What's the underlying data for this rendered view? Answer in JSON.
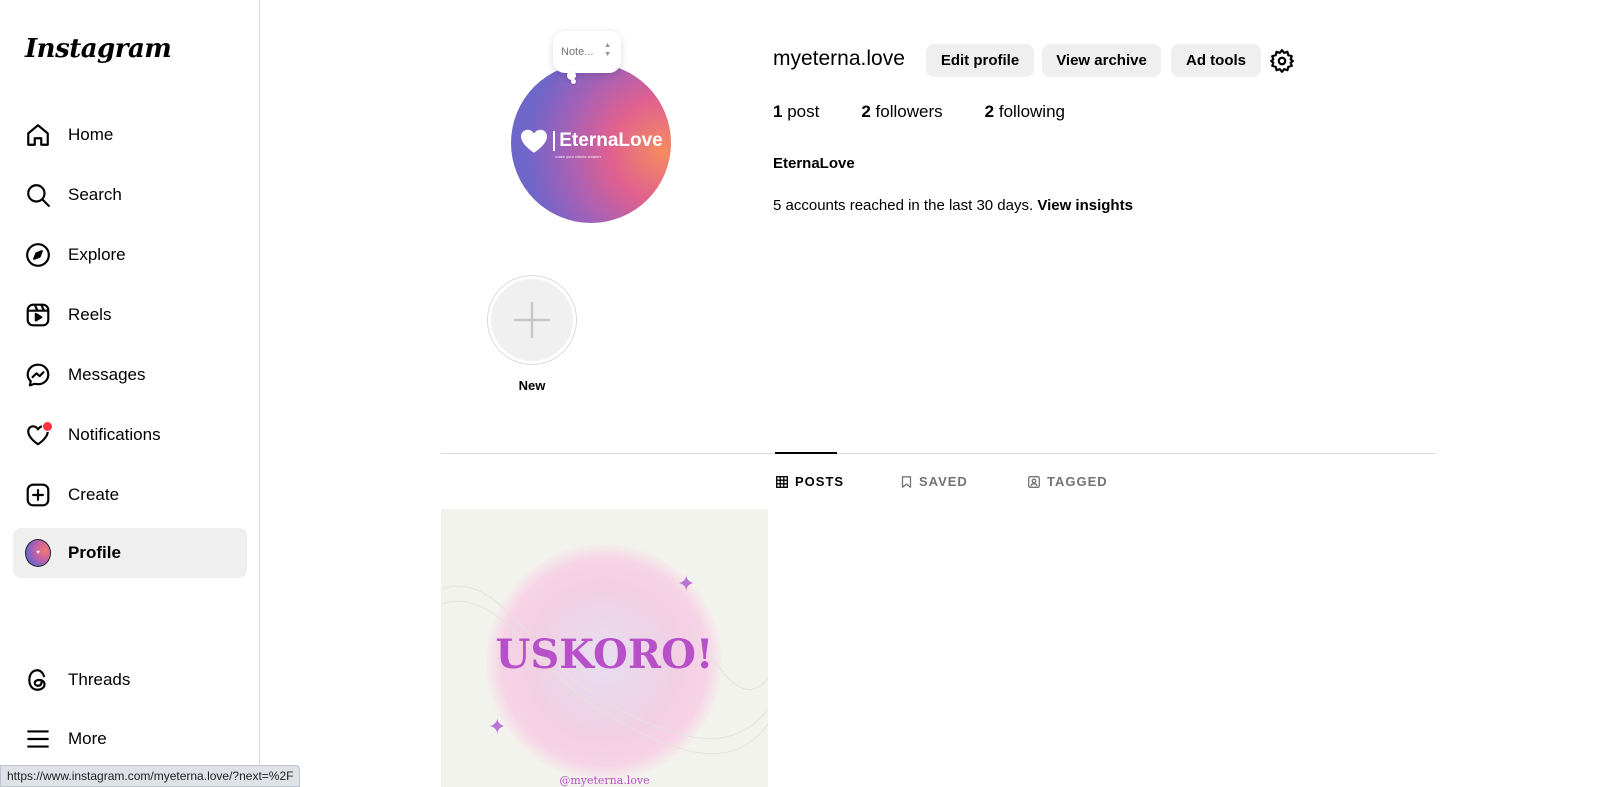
{
  "sidebar": {
    "logo": "Instagram",
    "items": [
      {
        "label": "Home"
      },
      {
        "label": "Search"
      },
      {
        "label": "Explore"
      },
      {
        "label": "Reels"
      },
      {
        "label": "Messages"
      },
      {
        "label": "Notifications"
      },
      {
        "label": "Create"
      },
      {
        "label": "Profile"
      },
      {
        "label": "Threads"
      },
      {
        "label": "More"
      }
    ]
  },
  "profile": {
    "note_placeholder": "Note...",
    "avatar_brand": "EternaLove",
    "avatar_tagline": "make your clients smarter",
    "username": "myeterna.love",
    "buttons": {
      "edit": "Edit profile",
      "archive": "View archive",
      "ad_tools": "Ad tools"
    },
    "stats": {
      "posts_num": "1",
      "posts_label": "post",
      "followers_num": "2",
      "followers_label": "followers",
      "following_num": "2",
      "following_label": "following"
    },
    "full_name": "EternaLove",
    "insights_text": "5 accounts reached in the last 30 days.",
    "insights_link": "View insights"
  },
  "highlight": {
    "label": "New"
  },
  "tabs": [
    {
      "label": "POSTS"
    },
    {
      "label": "SAVED"
    },
    {
      "label": "TAGGED"
    }
  ],
  "posts": [
    {
      "title": "USKORO!",
      "handle": "@myeterna.love"
    }
  ],
  "statusbar": {
    "url": "https://www.instagram.com/myeterna.love/?next=%2F"
  },
  "colors": {
    "notification_dot": "#ff3040",
    "post_accent": "#b64fc8",
    "button_bg": "#efefef"
  }
}
